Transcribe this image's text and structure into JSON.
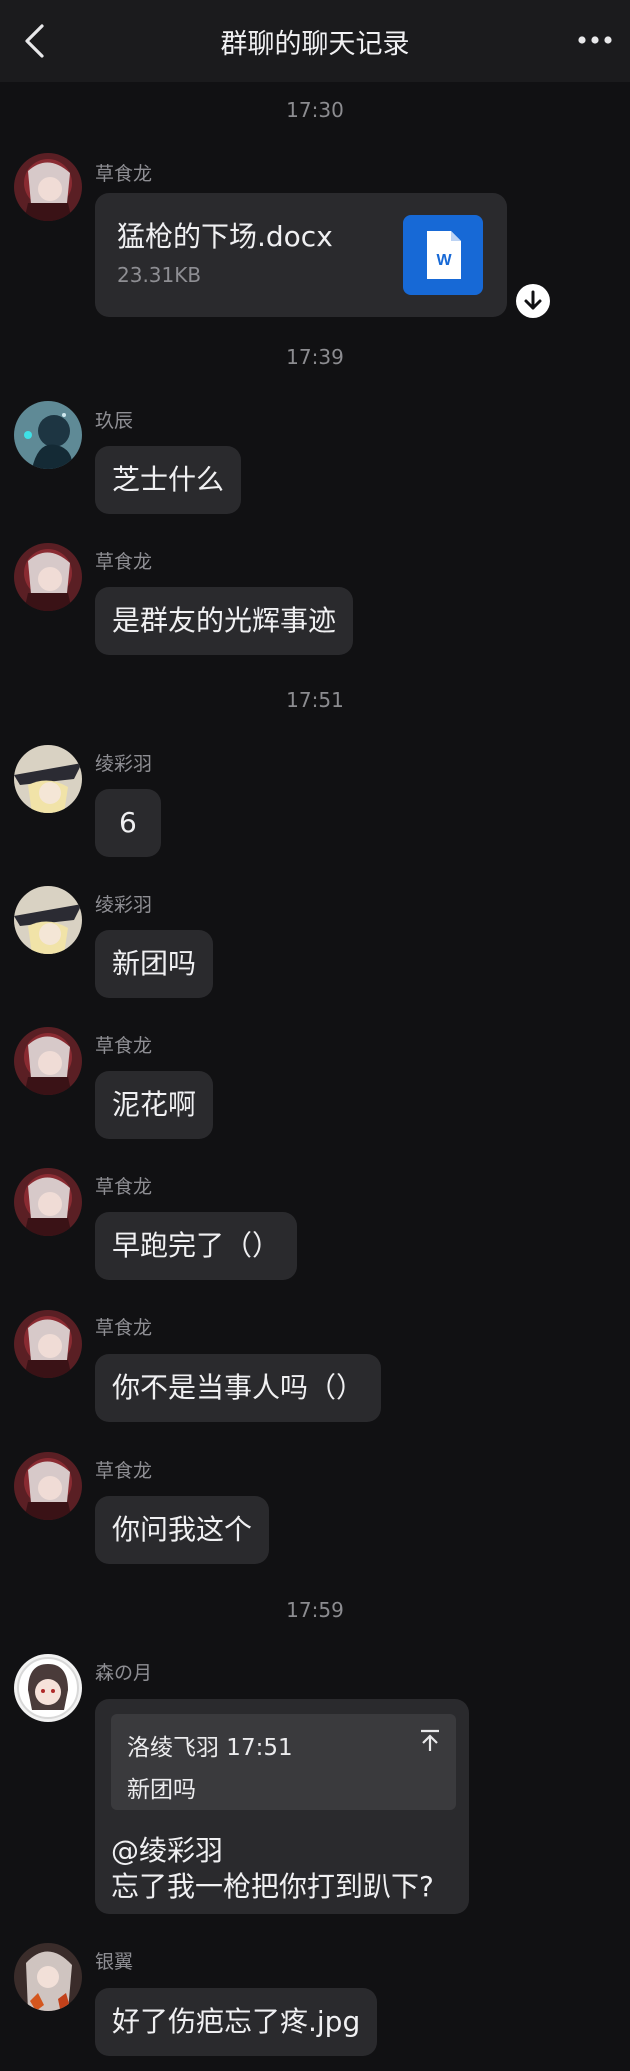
{
  "header": {
    "title": "群聊的聊天记录"
  },
  "timestamps": [
    "17:30",
    "17:39",
    "17:51",
    "17:59"
  ],
  "file_message": {
    "sender": "草食龙",
    "file_name": "猛枪的下场.docx",
    "file_size": "23.31KB",
    "icon_letter": "W"
  },
  "messages": [
    {
      "sender": "玖辰",
      "text": "芝士什么"
    },
    {
      "sender": "草食龙",
      "text": "是群友的光辉事迹"
    },
    {
      "sender": "绫彩羽",
      "text": "6"
    },
    {
      "sender": "绫彩羽",
      "text": "新团吗"
    },
    {
      "sender": "草食龙",
      "text": "泥花啊"
    },
    {
      "sender": "草食龙",
      "text": "早跑完了（）"
    },
    {
      "sender": "草食龙",
      "text": "你不是当事人吗（）"
    },
    {
      "sender": "草食龙",
      "text": "你问我这个"
    },
    {
      "sender": "银翼",
      "text": "好了伤疤忘了疼.jpg"
    }
  ],
  "reply_message": {
    "sender": "森の月",
    "quote_header": "洛绫飞羽 17:51",
    "quote_text": "新团吗",
    "line1": "@绫彩羽",
    "line2": " 忘了我一枪把你打到趴下?"
  },
  "colors": {
    "background": "#111113",
    "header": "#1b1b1d",
    "bubble": "#2a2a2d",
    "word_blue": "#1769d6"
  }
}
